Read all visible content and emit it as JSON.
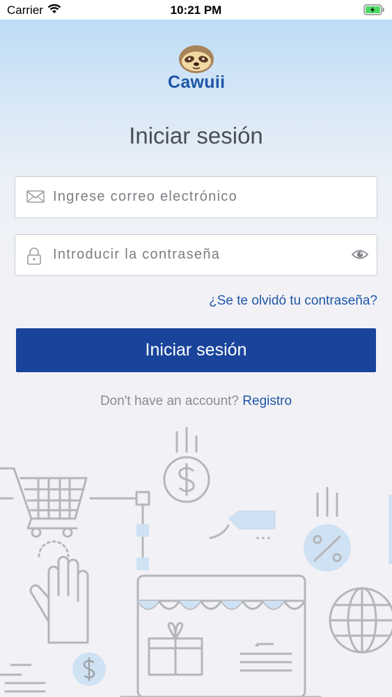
{
  "status_bar": {
    "carrier": "Carrier",
    "time": "10:21 PM"
  },
  "brand": {
    "name": "Cawuii",
    "color": "#1f56a8"
  },
  "login": {
    "title": "Iniciar sesión",
    "email_placeholder": "Ingrese correo electrónico",
    "password_placeholder": "Introducir la contraseña",
    "forgot_password": "¿Se te olvidó tu contraseña?",
    "submit_label": "Iniciar sesión",
    "no_account_text": "Don't have an account?",
    "register_link": "Registro"
  },
  "icons": {
    "email": "envelope-icon",
    "password": "lock-icon",
    "show_password": "eye-icon"
  },
  "colors": {
    "primary_button": "#1a449c",
    "link": "#1f56a8",
    "title": "#4a4f55"
  }
}
